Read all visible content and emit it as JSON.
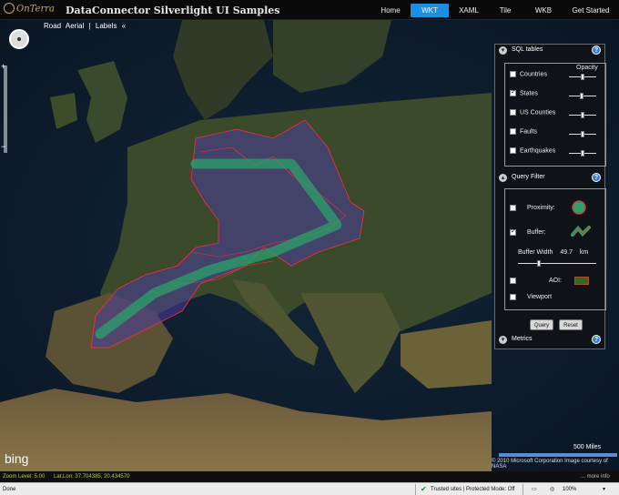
{
  "header": {
    "logo": "OnTerra",
    "title": "DataConnector Silverlight UI Samples",
    "nav": [
      "Home",
      "WKT",
      "XAML",
      "Tile",
      "WKB",
      "Get Started"
    ],
    "active_nav": "WKT",
    "accent": "#1d8fe0"
  },
  "map": {
    "modes": [
      "Road",
      "Aerial",
      "|",
      "Labels"
    ],
    "collapse_glyph": "«",
    "scale_label": "500 Miles",
    "copyright": "© 2010 Microsoft Corporation  Image courtesy of NASA",
    "brand": "bing",
    "overlay_color": "#5a3fa3",
    "polygon_edge": "#ff2a3a",
    "buffer_color": "#2aa36b",
    "zoom_in": "+",
    "zoom_out": "−"
  },
  "panel": {
    "sql": {
      "title": "SQL tables",
      "opacity_label": "Opacity",
      "tables": [
        {
          "label": "Countries",
          "checked": false,
          "opacity": 0.5
        },
        {
          "label": "States",
          "checked": true,
          "opacity": 0.45
        },
        {
          "label": "US Counties",
          "checked": false,
          "opacity": 0.5
        },
        {
          "label": "Faults",
          "checked": false,
          "opacity": 0.5
        },
        {
          "label": "Earthquakes",
          "checked": false,
          "opacity": 0.5
        }
      ]
    },
    "query": {
      "title": "Query Filter",
      "proximity": {
        "label": "Proximity:",
        "checked": false
      },
      "buffer": {
        "label": "Buffer:",
        "checked": true
      },
      "buffer_width_label": "Buffer Width",
      "buffer_width_value": "49.7",
      "buffer_unit": "km",
      "buffer_fraction": 0.25,
      "aoi": {
        "label": "AOI:",
        "checked": false
      },
      "viewport": {
        "label": "Viewport",
        "checked": false
      }
    },
    "buttons": {
      "query": "Query",
      "reset": "Reset"
    },
    "metrics": {
      "title": "Metrics"
    },
    "help": "?"
  },
  "infobar": {
    "zoom": "Zoom Level: 5.00",
    "latlon": "Lat,Lon: 37.704385, 20.434570",
    "more": "... more info"
  },
  "statusbar": {
    "left": "Done",
    "zone": "Trusted sites | Protected Mode: Off",
    "zoom": "100%"
  }
}
